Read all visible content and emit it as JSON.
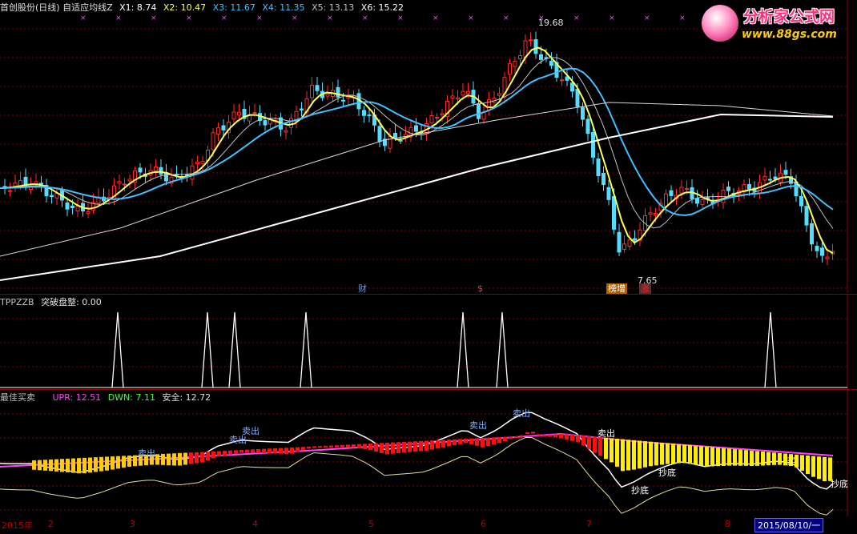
{
  "main": {
    "title": "首创股份(日线) 自适应均线Z",
    "ma": [
      {
        "label": "X1: 8.74",
        "color": "#ffffff"
      },
      {
        "label": "X2: 10.47",
        "color": "#ffff55"
      },
      {
        "label": "X3: 11.67",
        "color": "#40c0ff"
      },
      {
        "label": "X4: 11.35",
        "color": "#40c0ff"
      },
      {
        "label": "X5: 13.13",
        "color": "#c0c0c0"
      },
      {
        "label": "X6: 15.22",
        "color": "#ffffff"
      }
    ],
    "high_label": "19.68",
    "low_label": "7.65",
    "markers": [
      {
        "text": "财",
        "color": "#4aa0ff"
      },
      {
        "text": "$",
        "color": "#ff3030"
      },
      {
        "text": "榜增",
        "color": "#ffffff",
        "bg": "#b06000"
      },
      {
        "text": "涨",
        "color": "#ff2020",
        "bg": "#503030"
      }
    ]
  },
  "ind1": {
    "name": "TPPZZB",
    "label": "突破盘整: 0.00"
  },
  "ind2": {
    "name": "最佳买卖",
    "upr": "UPR: 12.51",
    "dwn": "DWN: 7.11",
    "safe": "安全: 12.72",
    "signals": [
      "卖出",
      "卖出",
      "卖出",
      "卖出",
      "卖出",
      "卖出",
      "抄底",
      "抄底",
      "抄底",
      "买"
    ]
  },
  "axis": {
    "ticks": [
      "2015年",
      "2",
      "3",
      "4",
      "5",
      "6",
      "7",
      "8"
    ],
    "cursor_date": "2015/08/10/一"
  },
  "logo": {
    "name": "分析家公式网",
    "url": "www.88gs.com"
  },
  "colors": {
    "up": "#ff2a2a",
    "down": "#55ddff",
    "grid": "#8b0000",
    "purple": "#ff40ff"
  }
}
